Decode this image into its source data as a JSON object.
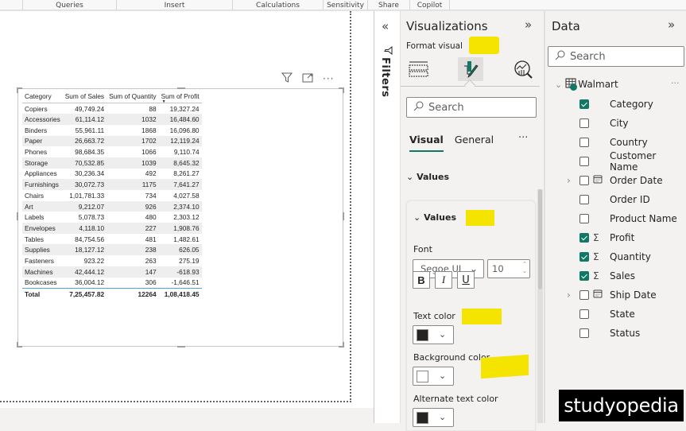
{
  "ribbon": {
    "groups": [
      "Queries",
      "Insert",
      "Calculations",
      "Sensitivity",
      "Share",
      "Copilot"
    ]
  },
  "visual_header": {
    "icons": [
      "filter-icon",
      "focus-mode-icon",
      "more-options-icon"
    ],
    "more": "···"
  },
  "table": {
    "columns": [
      "Category",
      "Sum of Sales",
      "Sum of Quantity",
      "Sum of Profit"
    ],
    "sorted_column": "Sum of Profit",
    "sort_direction": "descending",
    "rows": [
      [
        "Copiers",
        "49,749.24",
        "88",
        "19,327.24"
      ],
      [
        "Accessories",
        "61,114.12",
        "1032",
        "16,484.60"
      ],
      [
        "Binders",
        "55,961.11",
        "1868",
        "16,096.80"
      ],
      [
        "Paper",
        "26,663.72",
        "1702",
        "12,119.24"
      ],
      [
        "Phones",
        "98,684.35",
        "1066",
        "9,110.74"
      ],
      [
        "Storage",
        "70,532.85",
        "1039",
        "8,645.32"
      ],
      [
        "Appliances",
        "30,236.34",
        "492",
        "8,261.27"
      ],
      [
        "Furnishings",
        "30,072.73",
        "1175",
        "7,641.27"
      ],
      [
        "Chairs",
        "1,01,781.33",
        "734",
        "4,027.58"
      ],
      [
        "Art",
        "9,212.07",
        "926",
        "2,374.10"
      ],
      [
        "Labels",
        "5,078.73",
        "480",
        "2,303.12"
      ],
      [
        "Envelopes",
        "4,118.10",
        "227",
        "1,908.76"
      ],
      [
        "Tables",
        "84,754.56",
        "481",
        "1,482.61"
      ],
      [
        "Supplies",
        "18,127.12",
        "238",
        "626.05"
      ],
      [
        "Fasteners",
        "923.22",
        "263",
        "275.19"
      ],
      [
        "Machines",
        "42,444.12",
        "147",
        "-618.93"
      ],
      [
        "Bookcases",
        "36,004.12",
        "306",
        "-1,646.51"
      ]
    ],
    "total": [
      "Total",
      "7,25,457.82",
      "12264",
      "1,08,418.45"
    ]
  },
  "filters_pane": {
    "collapse": "«",
    "label": "Filters"
  },
  "visualizations": {
    "title": "Visualizations",
    "expand": "»",
    "subtitle": "Format visual",
    "search_placeholder": "Search",
    "tabs": [
      {
        "label": "Visual",
        "active": true
      },
      {
        "label": "General",
        "active": false
      }
    ],
    "tabs_more": "···",
    "section": "Values",
    "card": {
      "title": "Values",
      "font_label": "Font",
      "font_family": "Segoe UI",
      "font_size": "10",
      "bold": "B",
      "italic": "I",
      "underline": "U",
      "text_color_label": "Text color",
      "text_color": "#252423",
      "background_color_label": "Background color",
      "background_color": "#ffffff",
      "alt_text_color_label": "Alternate text color",
      "alt_text_color": "#252423"
    }
  },
  "data_pane": {
    "title": "Data",
    "expand": "»",
    "search_placeholder": "Search",
    "table_name": "Walmart",
    "more": "···",
    "fields": [
      {
        "name": "Category",
        "checked": true,
        "type": "",
        "expandable": false
      },
      {
        "name": "City",
        "checked": false,
        "type": "",
        "expandable": false
      },
      {
        "name": "Country",
        "checked": false,
        "type": "",
        "expandable": false
      },
      {
        "name": "Customer Name",
        "checked": false,
        "type": "",
        "expandable": false
      },
      {
        "name": "Order Date",
        "checked": false,
        "type": "calendar",
        "expandable": true
      },
      {
        "name": "Order ID",
        "checked": false,
        "type": "",
        "expandable": false
      },
      {
        "name": "Product Name",
        "checked": false,
        "type": "",
        "expandable": false
      },
      {
        "name": "Profit",
        "checked": true,
        "type": "sigma",
        "expandable": false
      },
      {
        "name": "Quantity",
        "checked": true,
        "type": "sigma",
        "expandable": false
      },
      {
        "name": "Sales",
        "checked": true,
        "type": "sigma",
        "expandable": false
      },
      {
        "name": "Ship Date",
        "checked": false,
        "type": "calendar",
        "expandable": true
      },
      {
        "name": "State",
        "checked": false,
        "type": "",
        "expandable": false
      },
      {
        "name": "Status",
        "checked": false,
        "type": "",
        "expandable": false
      }
    ]
  },
  "colors": {
    "accent": "#117865",
    "highlight": "#f5e400",
    "total_rule": "#4ea3d7"
  },
  "watermark": "studyopedia"
}
